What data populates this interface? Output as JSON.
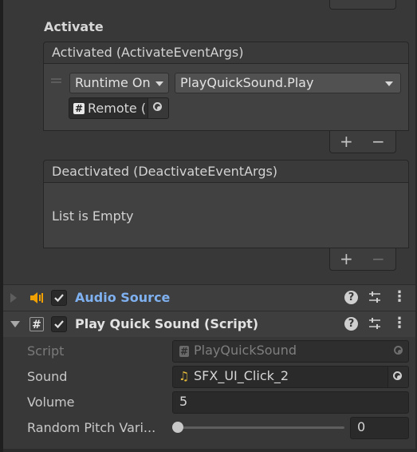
{
  "activate": {
    "heading": "Activate",
    "header": "Activated (ActivateEventArgs)",
    "item": {
      "runtime": "Runtime On",
      "function": "PlayQuickSound.Play",
      "object": "Remote ("
    },
    "add": "+",
    "remove": "−"
  },
  "deactivate": {
    "header": "Deactivated (DeactivateEventArgs)",
    "empty": "List is Empty",
    "add": "+",
    "remove": "−"
  },
  "top_tab": {
    "add": "+",
    "remove": "−"
  },
  "audio_source": {
    "title": "Audio Source",
    "help": "?",
    "more": "⋮"
  },
  "play_quick_sound": {
    "title": "Play Quick Sound (Script)",
    "help": "?",
    "more": "⋮",
    "fields": {
      "script": {
        "label": "Script",
        "value": "PlayQuickSound"
      },
      "sound": {
        "label": "Sound",
        "value": "SFX_UI_Click_2"
      },
      "volume": {
        "label": "Volume",
        "value": "5"
      },
      "pitch": {
        "label": "Random Pitch Vari...",
        "value": "0",
        "level": 0
      }
    }
  },
  "colors": {
    "accent": "#7fb1f0",
    "audio_icon": "#f0a000",
    "music_note": "#e2b93b"
  }
}
